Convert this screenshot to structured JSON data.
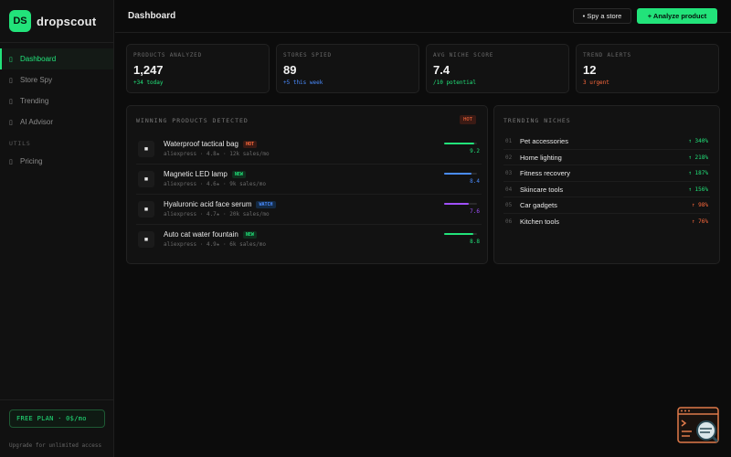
{
  "brand": {
    "logo": "DS",
    "name": "dropscout"
  },
  "sidebar": {
    "items": [
      {
        "label": "Dashboard",
        "icon": "grid-icon",
        "active": true
      },
      {
        "label": "Store Spy",
        "icon": "eye-icon",
        "active": false
      },
      {
        "label": "Trending",
        "icon": "trend-icon",
        "active": false
      },
      {
        "label": "AI Advisor",
        "icon": "spark-icon",
        "active": false
      }
    ],
    "section_label": "UTILS",
    "utils_items": [
      {
        "label": "Pricing",
        "icon": "tag-icon"
      }
    ],
    "plan_label": "FREE PLAN · 0$/mo",
    "plan_note": "Upgrade for unlimited access"
  },
  "header": {
    "title": "Dashboard",
    "spy_button": "• Spy a store",
    "analyze_button": "+ Analyze product"
  },
  "stats": [
    {
      "label": "PRODUCTS ANALYZED",
      "value": "1,247",
      "sub": "+34 today",
      "sub_color": "#22e37a"
    },
    {
      "label": "STORES SPIED",
      "value": "89",
      "sub": "+5 this week",
      "sub_color": "#4a8cff"
    },
    {
      "label": "AVG NICHE SCORE",
      "value": "7.4",
      "sub": "/10 potential",
      "sub_color": "#22e37a"
    },
    {
      "label": "TREND ALERTS",
      "value": "12",
      "sub": "3 urgent",
      "sub_color": "#ff6a3d"
    }
  ],
  "winning": {
    "title": "WINNING PRODUCTS DETECTED",
    "badge": "HOT",
    "products": [
      {
        "name": "Waterproof tactical bag",
        "tag": "HOT",
        "tag_bg": "#3a1a14",
        "tag_color": "#ff6a3d",
        "meta": "aliexpress · 4.8★ · 12k sales/mo",
        "score": "9.2",
        "score_value": 0.92,
        "color": "#22e37a"
      },
      {
        "name": "Magnetic LED lamp",
        "tag": "NEW",
        "tag_bg": "#10301e",
        "tag_color": "#22e37a",
        "meta": "aliexpress · 4.6★ · 9k sales/mo",
        "score": "8.4",
        "score_value": 0.84,
        "color": "#4a8cff"
      },
      {
        "name": "Hyaluronic acid face serum",
        "tag": "WATCH",
        "tag_bg": "#142a44",
        "tag_color": "#4a8cff",
        "meta": "aliexpress · 4.7★ · 20k sales/mo",
        "score": "7.6",
        "score_value": 0.76,
        "color": "#a050ff"
      },
      {
        "name": "Auto cat water fountain",
        "tag": "NEW",
        "tag_bg": "#10301e",
        "tag_color": "#22e37a",
        "meta": "aliexpress · 4.9★ · 6k sales/mo",
        "score": "8.8",
        "score_value": 0.88,
        "color": "#22e37a"
      }
    ]
  },
  "niches": {
    "title": "TRENDING NICHES",
    "items": [
      {
        "idx": "01",
        "name": "Pet accessories",
        "pct": "↑ 340%",
        "color": "#22e37a"
      },
      {
        "idx": "02",
        "name": "Home lighting",
        "pct": "↑ 218%",
        "color": "#22e37a"
      },
      {
        "idx": "03",
        "name": "Fitness recovery",
        "pct": "↑ 187%",
        "color": "#22e37a"
      },
      {
        "idx": "04",
        "name": "Skincare tools",
        "pct": "↑ 156%",
        "color": "#22e37a"
      },
      {
        "idx": "05",
        "name": "Car gadgets",
        "pct": "↑ 98%",
        "color": "#ff6a3d"
      },
      {
        "idx": "06",
        "name": "Kitchen tools",
        "pct": "↑ 76%",
        "color": "#ff6a3d"
      }
    ]
  },
  "colors": {
    "accent": "#22e37a",
    "blue": "#4a8cff",
    "orange": "#ff6a3d",
    "purple": "#a050ff"
  }
}
